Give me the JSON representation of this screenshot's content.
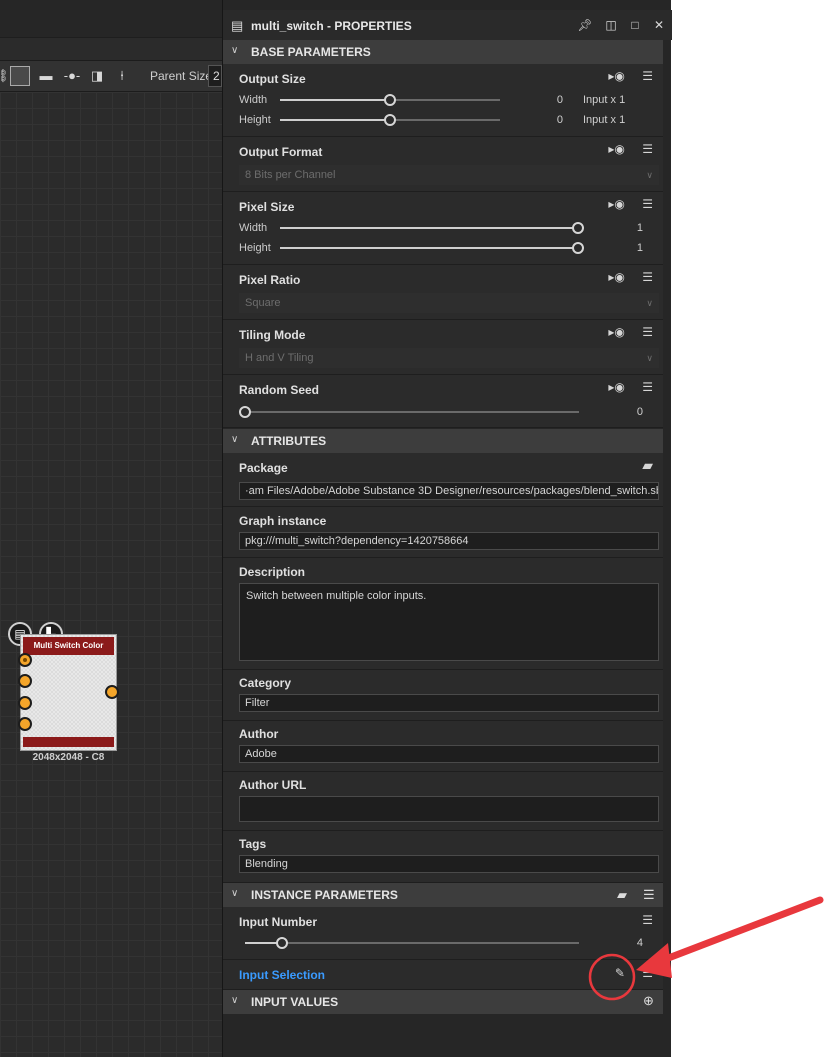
{
  "graph": {
    "parent_size_label": "Parent Size:",
    "parent_size_value": "2",
    "node": {
      "title": "Multi Switch Color",
      "caption": "2048x2048 - C8",
      "header_color": "#8b1a1a",
      "port_color": "#f4a52a"
    }
  },
  "panel": {
    "title": "multi_switch - PROPERTIES",
    "sections": {
      "base": "BASE PARAMETERS",
      "attributes": "ATTRIBUTES",
      "instance": "INSTANCE PARAMETERS",
      "input_values": "INPUT VALUES"
    },
    "output_size": {
      "title": "Output Size",
      "width_label": "Width",
      "width_value": "0",
      "width_unit": "Input x 1",
      "width_level": 0.5,
      "height_label": "Height",
      "height_value": "0",
      "height_unit": "Input x 1",
      "height_level": 0.5
    },
    "output_format": {
      "title": "Output Format",
      "value": "8 Bits per Channel"
    },
    "pixel_size": {
      "title": "Pixel Size",
      "width_label": "Width",
      "width_value": "1",
      "height_label": "Height",
      "height_value": "1"
    },
    "pixel_ratio": {
      "title": "Pixel Ratio",
      "value": "Square"
    },
    "tiling_mode": {
      "title": "Tiling Mode",
      "value": "H and V Tiling"
    },
    "random_seed": {
      "title": "Random Seed",
      "value": "0"
    },
    "package": {
      "title": "Package",
      "value": "·am Files/Adobe/Adobe Substance 3D Designer/resources/packages/blend_switch.sbs"
    },
    "graph_instance": {
      "title": "Graph instance",
      "value": "pkg:///multi_switch?dependency=1420758664"
    },
    "description": {
      "title": "Description",
      "value": "Switch between multiple color inputs."
    },
    "category": {
      "title": "Category",
      "value": "Filter"
    },
    "author": {
      "title": "Author",
      "value": "Adobe"
    },
    "author_url": {
      "title": "Author URL",
      "value": ""
    },
    "tags": {
      "title": "Tags",
      "value": "Blending"
    },
    "input_number": {
      "title": "Input Number",
      "value": "4"
    },
    "input_selection": {
      "title": "Input Selection"
    }
  },
  "colors": {
    "accent_blue": "#3a9bff",
    "annotation_red": "#e8383d"
  }
}
